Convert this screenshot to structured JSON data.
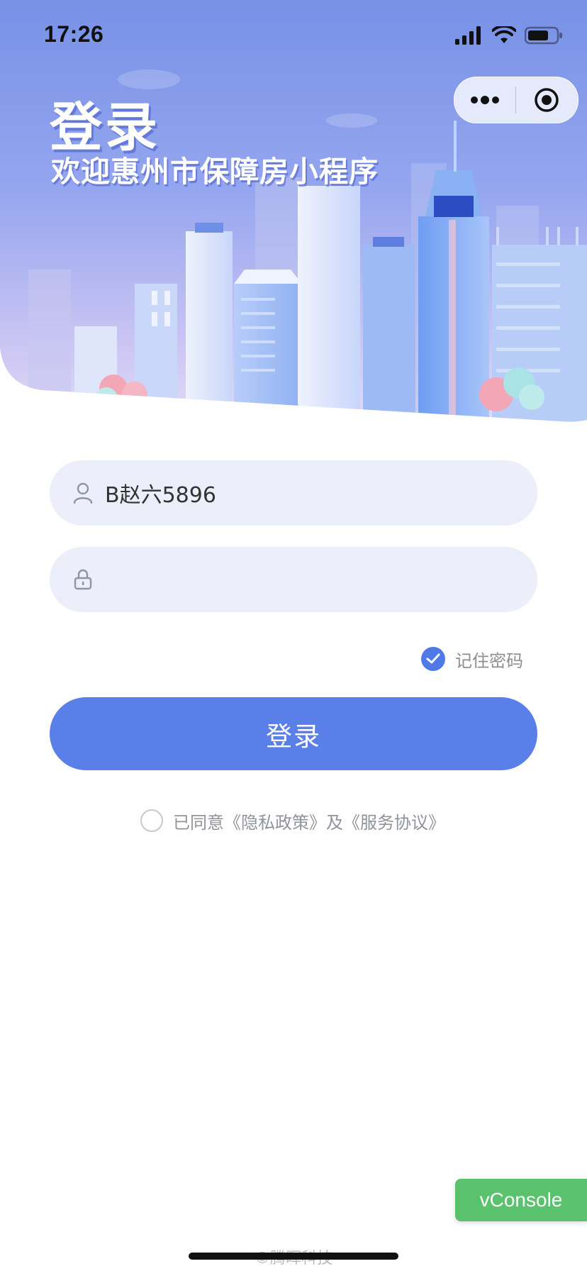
{
  "status_bar": {
    "time": "17:26",
    "icons": [
      "signal-icon",
      "wifi-icon",
      "battery-icon"
    ]
  },
  "capsule": {
    "icons": [
      "more-dots-icon",
      "target-close-icon"
    ]
  },
  "hero": {
    "title": "登录",
    "subtitle": "欢迎惠州市保障房小程序"
  },
  "form": {
    "username": {
      "value": "B赵六5896",
      "icon": "user-icon"
    },
    "password": {
      "value": "",
      "icon": "lock-icon"
    },
    "remember": {
      "label": "记住密码",
      "checked": true
    },
    "login_button": "登录"
  },
  "agreement": {
    "prefix": "已同意",
    "privacy_link": "《隐私政策》",
    "connector": "及",
    "service_link": "《服务协议》",
    "checked": false
  },
  "vconsole_label": "vConsole",
  "footer": "©腾晖科技",
  "colors": {
    "accent": "#5b7fe8",
    "check_on": "#4f79e6",
    "vconsole": "#5ac26d",
    "field_bg": "#eceef9"
  }
}
